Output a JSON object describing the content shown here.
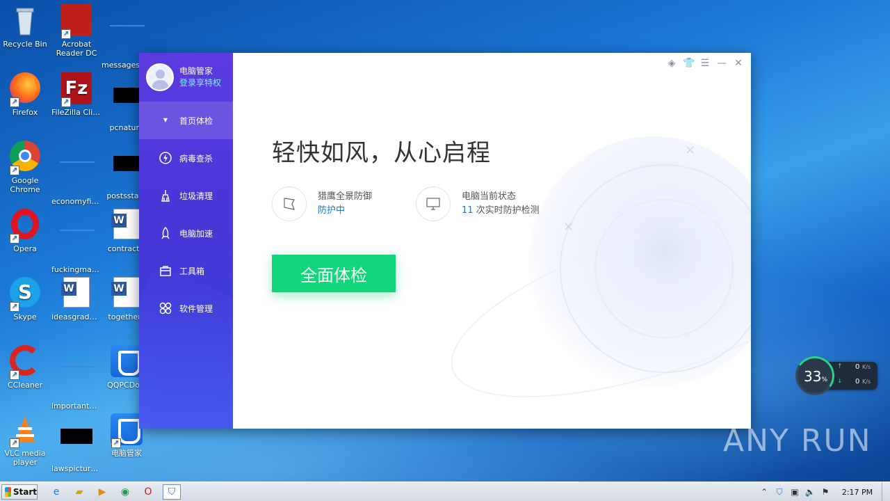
{
  "desktop": {
    "icons": [
      {
        "label": "Recycle Bin"
      },
      {
        "label": "Acrobat Reader DC"
      },
      {
        "label": "messagesd..."
      },
      {
        "label": "Firefox"
      },
      {
        "label": "FileZilla Client"
      },
      {
        "label": "pcnature"
      },
      {
        "label": "Google Chrome"
      },
      {
        "label": "economyfiv..."
      },
      {
        "label": "postsstate"
      },
      {
        "label": "Opera"
      },
      {
        "label": "fuckingmag..."
      },
      {
        "label": "contractsi"
      },
      {
        "label": "Skype"
      },
      {
        "label": "ideasgrade.rtf"
      },
      {
        "label": "togetherc"
      },
      {
        "label": "CCleaner"
      },
      {
        "label": "importantm..."
      },
      {
        "label": "QQPCDow"
      },
      {
        "label": "VLC media player"
      },
      {
        "label": "lawspicture..."
      },
      {
        "label": "电脑管家"
      }
    ]
  },
  "app": {
    "profile": {
      "name": "电脑管家",
      "login": "登录享特权"
    },
    "nav": [
      {
        "label": "首页体检",
        "icon": "shield-dot-icon"
      },
      {
        "label": "病毒查杀",
        "icon": "bolt-icon"
      },
      {
        "label": "垃圾清理",
        "icon": "broom-icon"
      },
      {
        "label": "电脑加速",
        "icon": "rocket-icon"
      },
      {
        "label": "工具箱",
        "icon": "toolbox-icon"
      },
      {
        "label": "软件管理",
        "icon": "apps-icon"
      }
    ],
    "headline": "轻快如风，从心启程",
    "stat1": {
      "label": "猎鹰全景防御",
      "value": "防护中"
    },
    "stat2": {
      "label": "电脑当前状态",
      "count": "11",
      "rest": " 次实时防护检测"
    },
    "scan_button": "全面体检"
  },
  "netwidget": {
    "percent": "33",
    "pct_sign": "%",
    "up": "0",
    "down": "0",
    "unit": "K/s"
  },
  "watermark": "ANY RUN",
  "taskbar": {
    "start": "Start",
    "time": "2:17 PM"
  }
}
